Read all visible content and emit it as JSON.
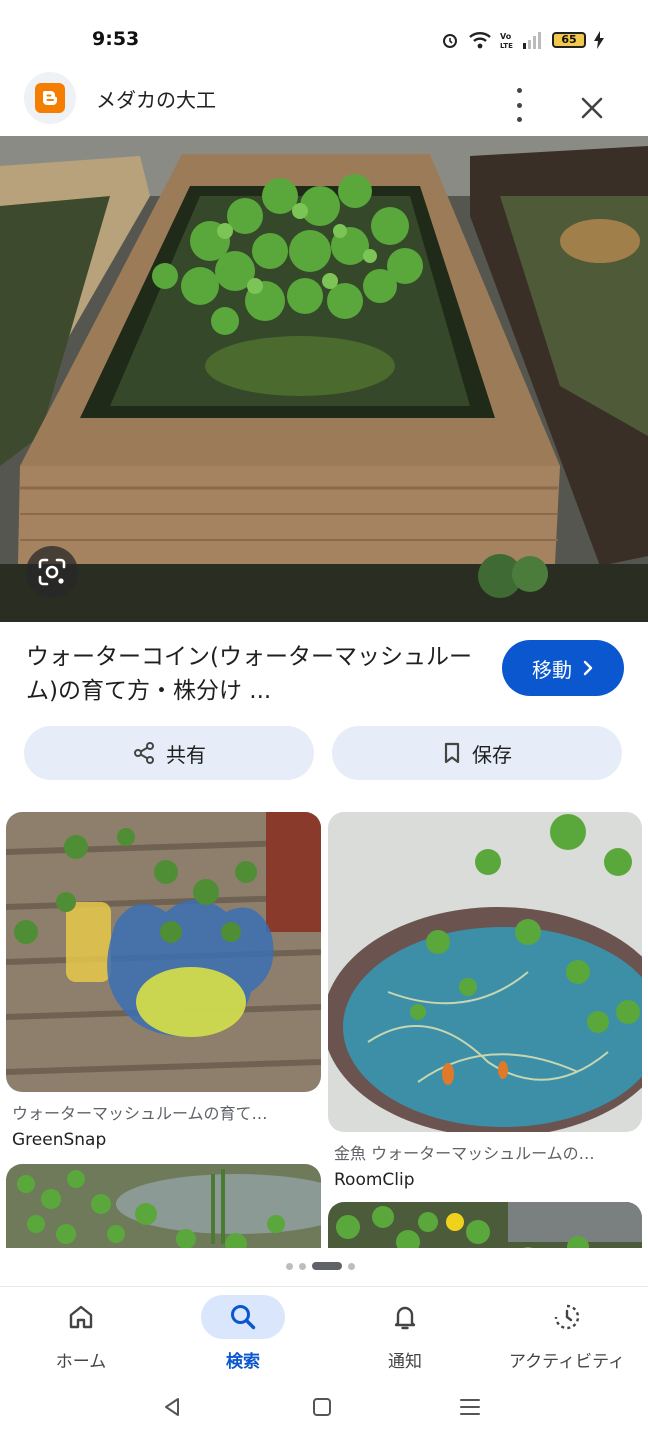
{
  "status": {
    "time": "9:53",
    "battery": "65"
  },
  "header": {
    "site_title": "メダカの大工"
  },
  "result": {
    "title": "ウォーターコイン(ウォーターマッシュルーム)の育て方・株分け ...",
    "visit_label": "移動"
  },
  "actions": {
    "share_label": "共有",
    "save_label": "保存"
  },
  "related": [
    {
      "caption": "ウォーターマッシュルームの育て…",
      "source": "GreenSnap"
    },
    {
      "caption": "金魚 ウォーターマッシュルームの…",
      "source": "RoomClip"
    }
  ],
  "bottom_nav": [
    {
      "label": "ホーム",
      "icon": "home-icon",
      "active": false
    },
    {
      "label": "検索",
      "icon": "search-icon",
      "active": true
    },
    {
      "label": "通知",
      "icon": "bell-icon",
      "active": false
    },
    {
      "label": "アクティビティ",
      "icon": "activity-icon",
      "active": false
    }
  ],
  "colors": {
    "accent": "#0b57d0",
    "pill_bg": "#e6edf8",
    "blogger_orange": "#f57d00"
  }
}
